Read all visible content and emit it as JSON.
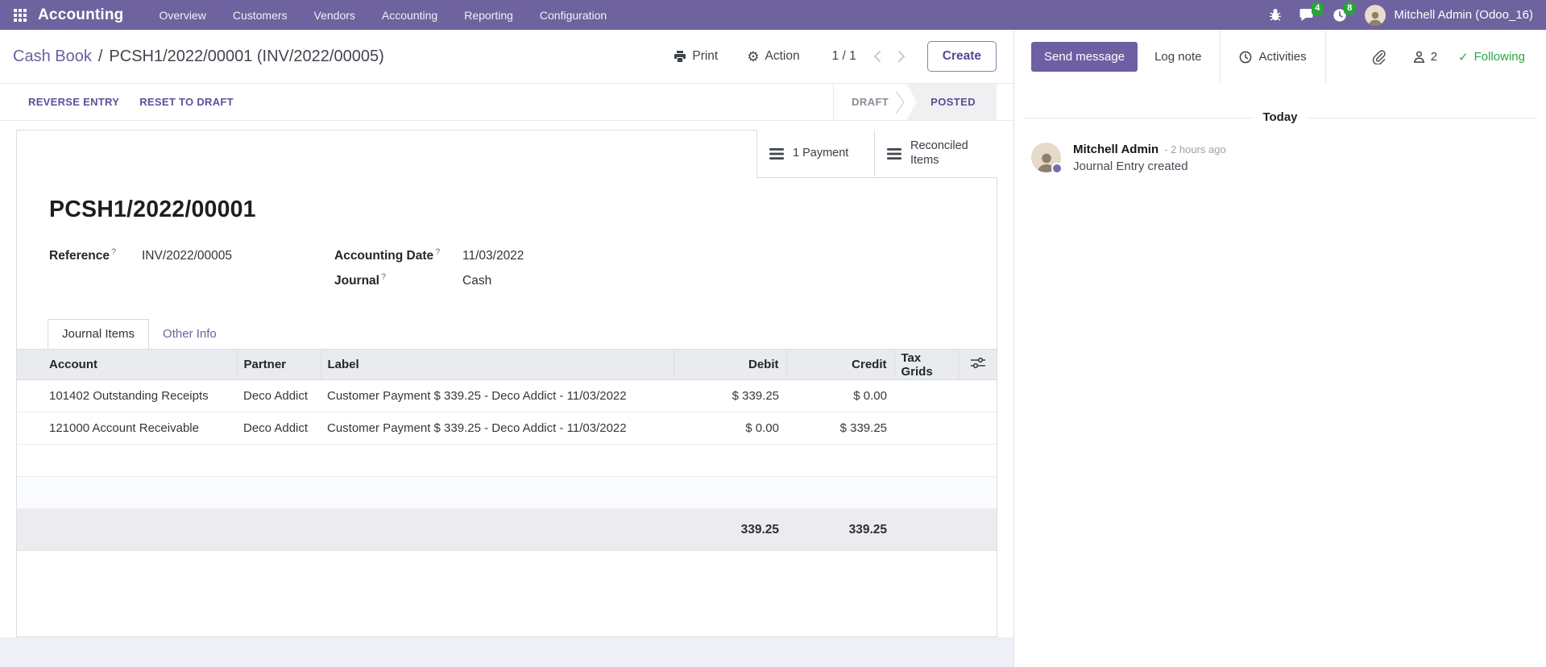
{
  "colors": {
    "navbar_bg": "#6e639e",
    "primary_purple": "#6e5fa3",
    "badge_green": "#2ba33c",
    "following_green": "#28a745",
    "table_header_bg": "#e9ebee",
    "totals_row_bg": "#ececee"
  },
  "navbar": {
    "app_name": "Accounting",
    "menu_items": [
      "Overview",
      "Customers",
      "Vendors",
      "Accounting",
      "Reporting",
      "Configuration"
    ],
    "messages_badge": "4",
    "activities_badge": "8",
    "user_name": "Mitchell Admin (Odoo_16)"
  },
  "control_panel": {
    "breadcrumb": {
      "parent": "Cash Book",
      "separator": "/",
      "current": "PCSH1/2022/00001 (INV/2022/00005)"
    },
    "print_label": "Print",
    "action_label": "Action",
    "gear_glyph": "⚙",
    "pager_value": "1 / 1",
    "create_label": "Create"
  },
  "statusbar": {
    "reverse_entry_label": "REVERSE ENTRY",
    "reset_to_draft_label": "RESET TO DRAFT",
    "draft_label": "DRAFT",
    "posted_label": "POSTED"
  },
  "sheet": {
    "smart_buttons": [
      {
        "label": "1 Payment"
      },
      {
        "label": "Reconciled Items"
      }
    ],
    "title": "PCSH1/2022/00001",
    "fields": {
      "reference": {
        "label": "Reference",
        "help": "?",
        "value": "INV/2022/00005"
      },
      "accounting_date": {
        "label": "Accounting Date",
        "help": "?",
        "value": "11/03/2022"
      },
      "journal": {
        "label": "Journal",
        "help": "?",
        "value": "Cash"
      }
    },
    "tabs": [
      {
        "label": "Journal Items"
      },
      {
        "label": "Other Info"
      }
    ],
    "table": {
      "headers": [
        "Account",
        "Partner",
        "Label",
        "Debit",
        "Credit",
        "Tax Grids"
      ],
      "rows": [
        {
          "account": "101402 Outstanding Receipts",
          "partner": "Deco Addict",
          "label": "Customer Payment $ 339.25 - Deco Addict - 11/03/2022",
          "debit": "$ 339.25",
          "credit": "$ 0.00"
        },
        {
          "account": "121000 Account Receivable",
          "partner": "Deco Addict",
          "label": "Customer Payment $ 339.25 - Deco Addict - 11/03/2022",
          "debit": "$ 0.00",
          "credit": "$ 339.25"
        }
      ],
      "totals": {
        "debit": "339.25",
        "credit": "339.25"
      }
    }
  },
  "chatter": {
    "send_message_label": "Send message",
    "log_note_label": "Log note",
    "activities_label": "Activities",
    "followers_count": "2",
    "check_glyph": "✓",
    "following_label": "Following",
    "date_separator": "Today",
    "messages": [
      {
        "author": "Mitchell Admin",
        "time": "- 2 hours ago",
        "body": "Journal Entry created"
      }
    ]
  }
}
